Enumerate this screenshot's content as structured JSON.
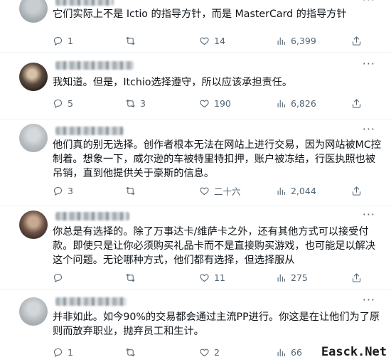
{
  "tweets": [
    {
      "text": "它们实际上不是 Ictio 的指导方针，而是 MasterCard 的指导方针",
      "reply": "1",
      "retweet": "",
      "like": "14",
      "views": "6,399"
    },
    {
      "text": "我知道。但是，Itchio选择遵守，所以应该承担责任。",
      "reply": "5",
      "retweet": "3",
      "like": "190",
      "views": "6,826"
    },
    {
      "text": "他们真的别无选择。创作者根本无法在网站上进行交易，因为网站被MC控制着。想象一下，威尔逊的车被特里特扣押，账户被冻结，行医执照也被吊销，直到他提供关于豪斯的信息。",
      "reply": "3",
      "retweet": "",
      "like": "二十六",
      "views": "2,044"
    },
    {
      "text": "你总是有选择的。除了万事达卡/维萨卡之外，还有其他方式可以接受付款。即使只是让你必须购买礼品卡而不是直接购买游戏，也可能足以解决这个问题。无论哪种方式，他们都有选择，但选择服从",
      "reply": "",
      "retweet": "",
      "like": "11",
      "views": "275"
    },
    {
      "text": "并非如此。如今90%的交易都会通过主流PP进行。你这是在让他们为了原则而放弃职业，抛弃员工和生计。",
      "reply": "1",
      "retweet": "",
      "like": "2",
      "views": "66"
    }
  ],
  "watermark": "Easck.Net",
  "icons": [
    "reply-icon",
    "retweet-icon",
    "like-icon",
    "views-icon",
    "bookmark-icon",
    "more-icon"
  ]
}
